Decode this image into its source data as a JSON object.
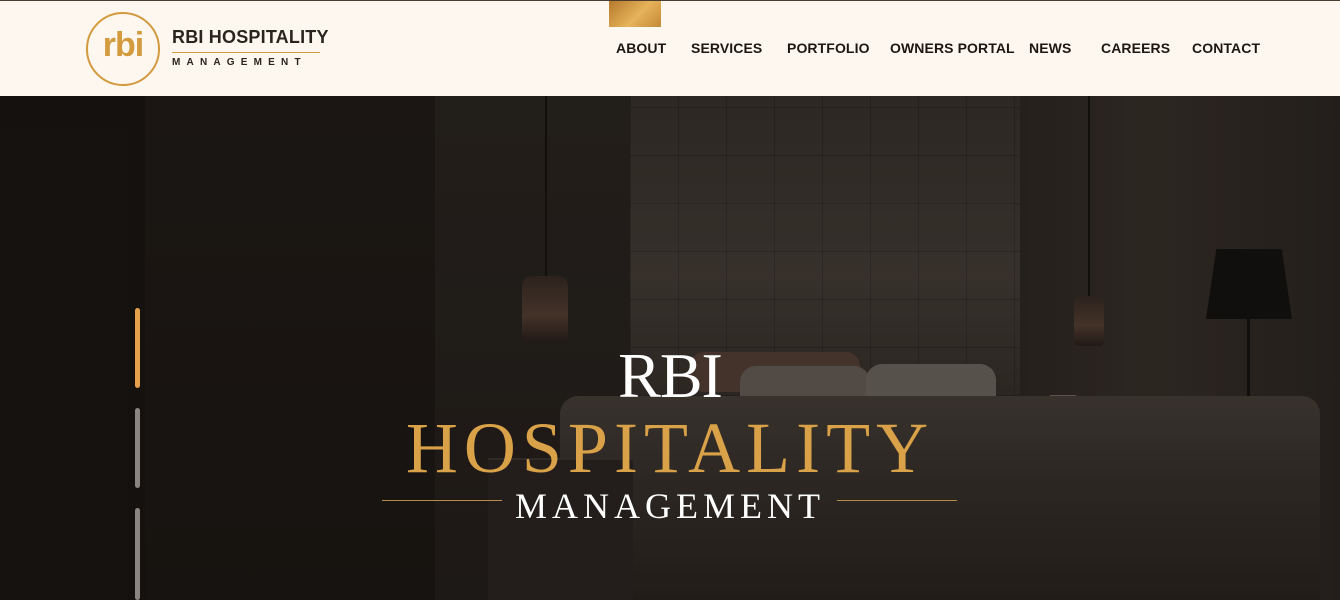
{
  "brand": {
    "logo_glyph": "rbi",
    "title": "RBI HOSPITALITY",
    "subtitle": "MANAGEMENT",
    "accent_color": "#d39a3e"
  },
  "nav": {
    "items": [
      {
        "label": "ABOUT"
      },
      {
        "label": "SERVICES"
      },
      {
        "label": "PORTFOLIO"
      },
      {
        "label": "OWNERS PORTAL"
      },
      {
        "label": "NEWS"
      },
      {
        "label": "CAREERS"
      },
      {
        "label": "CONTACT"
      }
    ]
  },
  "hero": {
    "line1": "RBI",
    "line2": "HOSPITALITY",
    "line3": "MANAGEMENT",
    "slides": {
      "count": 3,
      "active_index": 0
    }
  },
  "colors": {
    "header_bg": "#fdf7ef",
    "gold": "#d9a148",
    "indicator_active": "#e3a14a",
    "indicator_inactive": "#8a8580"
  }
}
